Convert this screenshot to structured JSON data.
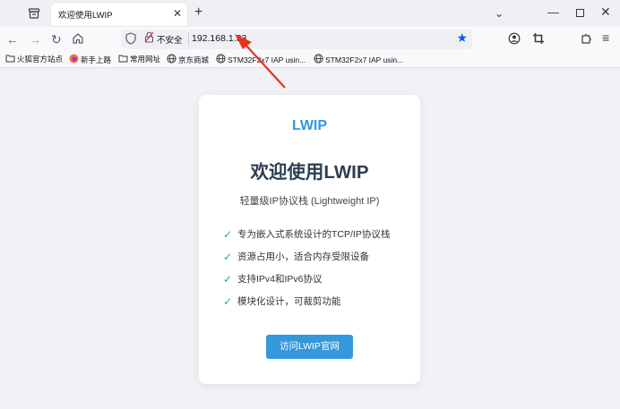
{
  "browser": {
    "tab": {
      "title": "欢迎使用LWIP",
      "close": "✕"
    },
    "new_tab": "+",
    "tab_list": "⌄",
    "window": {
      "minimize": "—",
      "close": "✕"
    },
    "nav": {
      "back": "←",
      "forward": "→",
      "reload": "↻"
    },
    "address": {
      "security_label": "不安全",
      "url": "192.168.1.33"
    },
    "bookmarks": [
      {
        "label": "火狐官方站点",
        "icon": "folder-icon"
      },
      {
        "label": "新手上路",
        "icon": "firefox-icon"
      },
      {
        "label": "常用网址",
        "icon": "folder-icon"
      },
      {
        "label": "京东商城",
        "icon": "globe-icon"
      },
      {
        "label": "STM32F2x7 IAP usin...",
        "icon": "globe-icon"
      },
      {
        "label": "STM32F2x7 IAP usin...",
        "icon": "globe-icon"
      }
    ]
  },
  "page": {
    "brand": "LWIP",
    "title": "欢迎使用LWIP",
    "subtitle": "轻量级IP协议栈 (Lightweight IP)",
    "check": "✓",
    "features": [
      "专为嵌入式系统设计的TCP/IP协议栈",
      "资源占用小，适合内存受限设备",
      "支持IPv4和IPv6协议",
      "模块化设计，可裁剪功能"
    ],
    "button": "访问LWIP官网"
  },
  "colors": {
    "brand": "#3498db",
    "title": "#2c3e50",
    "check": "#27ae60",
    "annotation_arrow": "#e8321e"
  }
}
